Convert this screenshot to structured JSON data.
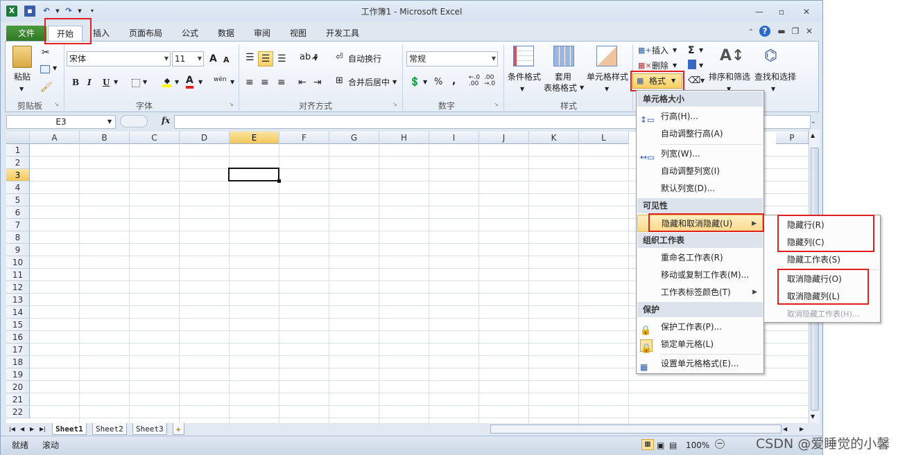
{
  "window": {
    "title": "工作簿1 - Microsoft Excel"
  },
  "tabs": [
    "文件",
    "开始",
    "插入",
    "页面布局",
    "公式",
    "数据",
    "审阅",
    "视图",
    "开发工具"
  ],
  "ribbon": {
    "clipboard": {
      "paste": "粘贴",
      "group": "剪贴板"
    },
    "font": {
      "name": "宋体",
      "size": "11",
      "group": "字体",
      "bold": "B",
      "italic": "I",
      "underline": "U",
      "grow": "A",
      "shrink": "A",
      "color": "A",
      "phonetic": "wén"
    },
    "alignment": {
      "wrap": "自动换行",
      "merge": "合并后居中",
      "group": "对齐方式"
    },
    "number": {
      "format": "常规",
      "group": "数字",
      "percent": "%",
      "comma": ","
    },
    "styles": {
      "conditional": "条件格式",
      "table_l1": "套用",
      "table_l2": "表格格式",
      "cell": "单元格样式",
      "group": "样式"
    },
    "cells": {
      "insert": "插入",
      "delete": "删除",
      "format": "格式"
    },
    "editing": {
      "sigma": "Σ",
      "sort": "排序和筛选",
      "find": "查找和选择"
    }
  },
  "formula": {
    "namebox": "E3",
    "fx": "fx"
  },
  "columns": [
    "A",
    "B",
    "C",
    "D",
    "E",
    "F",
    "G",
    "H",
    "I",
    "J",
    "K",
    "L",
    "P"
  ],
  "rows": [
    "1",
    "2",
    "3",
    "4",
    "5",
    "6",
    "7",
    "8",
    "9",
    "10",
    "11",
    "12",
    "13",
    "14",
    "15",
    "16",
    "17",
    "18",
    "19",
    "20",
    "21",
    "22"
  ],
  "sheets": [
    "Sheet1",
    "Sheet2",
    "Sheet3"
  ],
  "status": {
    "ready": "就绪",
    "scroll": "滚动",
    "zoom": "100%"
  },
  "format_menu": {
    "h_size": "单元格大小",
    "row_height": "行高(H)...",
    "autofit_row": "自动调整行高(A)",
    "col_width": "列宽(W)...",
    "autofit_col": "自动调整列宽(I)",
    "default_width": "默认列宽(D)...",
    "h_visibility": "可见性",
    "hide_unhide": "隐藏和取消隐藏(U)",
    "h_organize": "组织工作表",
    "rename": "重命名工作表(R)",
    "move_copy": "移动或复制工作表(M)...",
    "tab_color": "工作表标签颜色(T)",
    "h_protect": "保护",
    "protect_sheet": "保护工作表(P)...",
    "lock_cell": "锁定单元格(L)",
    "format_cells": "设置单元格格式(E)..."
  },
  "hide_submenu": {
    "hide_rows": "隐藏行(R)",
    "hide_cols": "隐藏列(C)",
    "hide_sheet": "隐藏工作表(S)",
    "unhide_rows": "取消隐藏行(O)",
    "unhide_cols": "取消隐藏列(L)",
    "unhide_sheet": "取消隐藏工作表(H)..."
  },
  "watermark": "CSDN @爱睡觉的小馨",
  "colors": {
    "accent_red": "#e02020",
    "file_tab": "#2f7a25",
    "highlight": "#fad98a"
  }
}
